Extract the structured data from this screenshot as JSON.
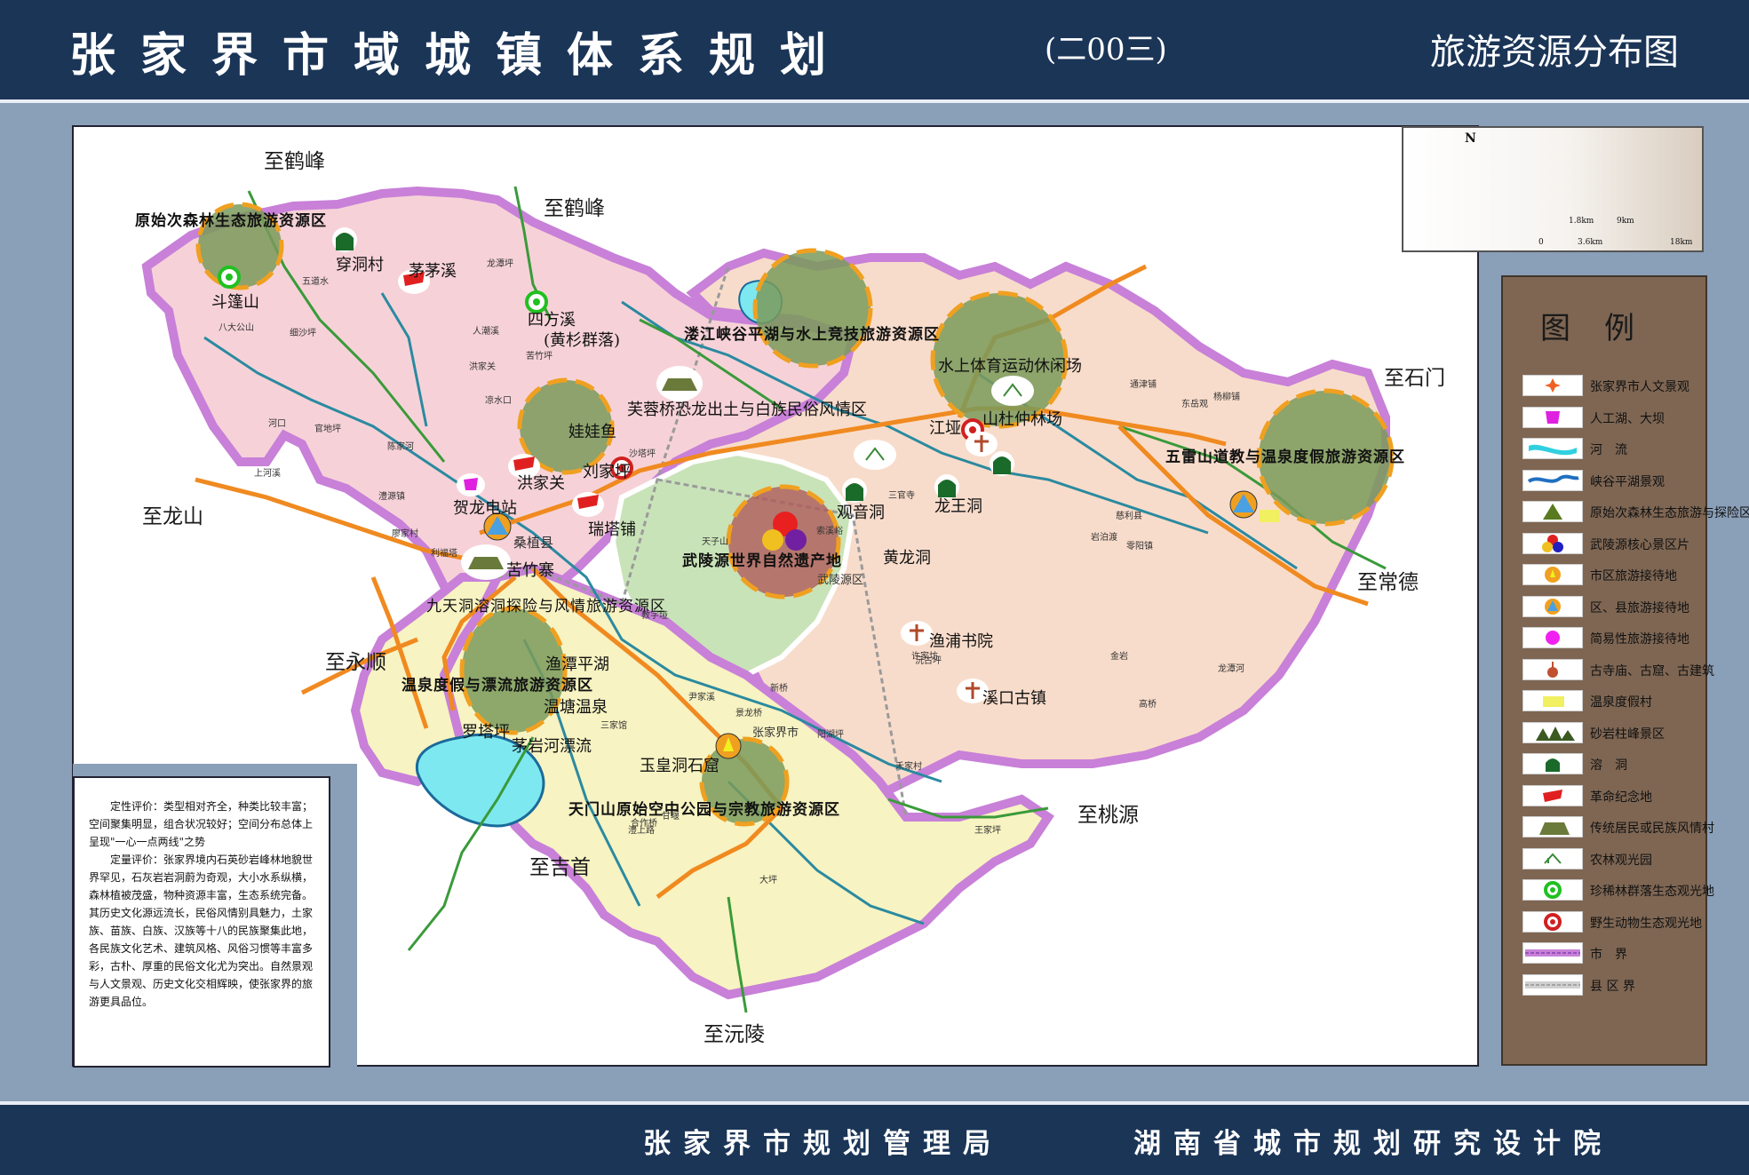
{
  "header": {
    "title": "张家界市域城镇体系规划",
    "year": "(二00三)",
    "subtitle": "旅游资源分布图"
  },
  "footer": {
    "left": "张家界市规划管理局",
    "right": "湖南省城市规划研究设计院"
  },
  "directions": {
    "hefeng1": "至鹤峰",
    "hefeng2": "至鹤峰",
    "longshan": "至龙山",
    "yongshun": "至永顺",
    "jishou": "至吉首",
    "yuanling": "至沅陵",
    "taoyuan": "至桃源",
    "changde": "至常德",
    "shimen": "至石门"
  },
  "zones": {
    "z1": "原始次森林生态旅游资源区",
    "z2": "溇江峡谷平湖与水上竞技旅游资源区",
    "z3": "五雷山道教与温泉度假旅游资源区",
    "z4": "武陵源世界自然遗产地",
    "z5": "九天洞溶洞探险与风情旅游资源区",
    "z6": "温泉度假与漂流旅游资源区",
    "z7": "天门山原始空中公园与宗教旅游资源区"
  },
  "spots": {
    "chuandong": "穿洞村",
    "maomaoxi": "茅茅溪",
    "doupengshan": "斗篷山",
    "sifangxi": "四方溪",
    "huangshan": "(黄杉群落)",
    "furongqiao": "芙蓉桥恐龙出土与白族民俗风情区",
    "shuishang": "水上体育运动休闲场",
    "shanshan": "山杜仲林场",
    "jiangya": "江垭",
    "wawayu": "娃娃鱼",
    "liujiaping": "刘家坪",
    "hongjiaguan": "洪家关",
    "helong": "贺龙电站",
    "sangzhi": "桑植县",
    "ruitapu": "瑞塔铺",
    "kuzhuzhai": "苦竹寨",
    "guanyindong": "观音洞",
    "longgongdong": "龙王洞",
    "huanglongdong": "黄龙洞",
    "yupu": "渔浦书院",
    "xikou": "溪口古镇",
    "yutan": "渔潭平湖",
    "wentang": "温塘温泉",
    "luotaping": "罗塔坪",
    "maoyanhe": "茅岩河漂流",
    "yuhuangdong": "玉皇洞石窟",
    "wulingyuan": "武陵源区",
    "zjjcity": "张家界市"
  },
  "small_places": [
    "五道水",
    "八大公山",
    "细沙坪",
    "洪家关",
    "龙潭坪",
    "人潮溪",
    "苦竹坪",
    "凉水口",
    "官地坪",
    "河口",
    "上河溪",
    "陈家河",
    "澧源镇",
    "利福塔",
    "廖家村",
    "沙塔坪",
    "天子山",
    "索溪峪",
    "王家坪",
    "许家坊",
    "慈利县",
    "零阳镇",
    "岩泊渡",
    "通津铺",
    "东岳观",
    "杨柳铺",
    "高桥",
    "龙潭河",
    "金岩",
    "三官寺",
    "阳湖坪",
    "新桥",
    "沅古坪",
    "尹家溪",
    "教字垭",
    "大坪",
    "三家馆",
    "合作桥",
    "甘堰",
    "景龙桥",
    "禾家村",
    "澧上路"
  ],
  "description": {
    "p1": "定性评价：类型相对齐全，种类比较丰富；空间聚集明显，组合状况较好；空间分布总体上呈现\"一心一点两线\"之势",
    "p2": "定量评价：张家界境内石英砂岩峰林地貌世界罕见，石灰岩岩洞蔚为奇观，大小水系纵横，森林植被茂盛，物种资源丰富，生态系统完备。其历史文化源远流长，民俗风情别具魅力，土家族、苗族、白族、汉族等十八的民族聚集此地，各民族文化艺术、建筑风格、风俗习惯等丰富多彩，古朴、厚重的民俗文化尤为突出。自然景观与人文景观、历史文化交相辉映，使张家界的旅游更具品位。"
  },
  "compass": {
    "north": "N",
    "scale1": "1.8km",
    "scale2": "9km",
    "scale3": "0",
    "scale4": "3.6km",
    "scale5": "18km"
  },
  "legend": {
    "title": "图例",
    "items": [
      {
        "label": "张家界市人文景观",
        "icon": "cross-star-icon"
      },
      {
        "label": "人工湖、大坝",
        "icon": "lake-dam-icon"
      },
      {
        "label": "河　流",
        "icon": "river-icon"
      },
      {
        "label": "峡谷平湖景观",
        "icon": "gorge-lake-icon"
      },
      {
        "label": "原始次森林生态旅游与探险区",
        "icon": "forest-triangle-icon"
      },
      {
        "label": "武陵源核心景区片",
        "icon": "core-zone-icon"
      },
      {
        "label": "市区旅游接待地",
        "icon": "city-reception-icon"
      },
      {
        "label": "区、县旅游接待地",
        "icon": "county-reception-icon"
      },
      {
        "label": "简易性旅游接待地",
        "icon": "simple-reception-icon"
      },
      {
        "label": "古寺庙、古窟、古建筑",
        "icon": "temple-icon"
      },
      {
        "label": "温泉度假村",
        "icon": "hot-spring-icon"
      },
      {
        "label": "砂岩柱峰景区",
        "icon": "sandstone-peak-icon"
      },
      {
        "label": "溶　洞",
        "icon": "cave-icon"
      },
      {
        "label": "革命纪念地",
        "icon": "red-flag-icon"
      },
      {
        "label": "传统居民或民族风情村",
        "icon": "village-icon"
      },
      {
        "label": "农林观光园",
        "icon": "farm-icon"
      },
      {
        "label": "珍稀林群落生态观光地",
        "icon": "rare-forest-icon"
      },
      {
        "label": "野生动物生态观光地",
        "icon": "wildlife-icon"
      },
      {
        "label": "市　界",
        "icon": "city-boundary-icon"
      },
      {
        "label": "县 区 界",
        "icon": "county-boundary-icon"
      }
    ]
  },
  "colors": {
    "sangzhi": "#f6d2d8",
    "wulingyuan": "#c9e3b8",
    "cili": "#f8dccb",
    "yongding": "#f7f3c2",
    "boundary": "#c880d8",
    "road": "#f08a20",
    "highway": "#3a9a3a",
    "river": "#2a8aa0",
    "zone": "#7a9a5a",
    "header": "#1b3557"
  }
}
